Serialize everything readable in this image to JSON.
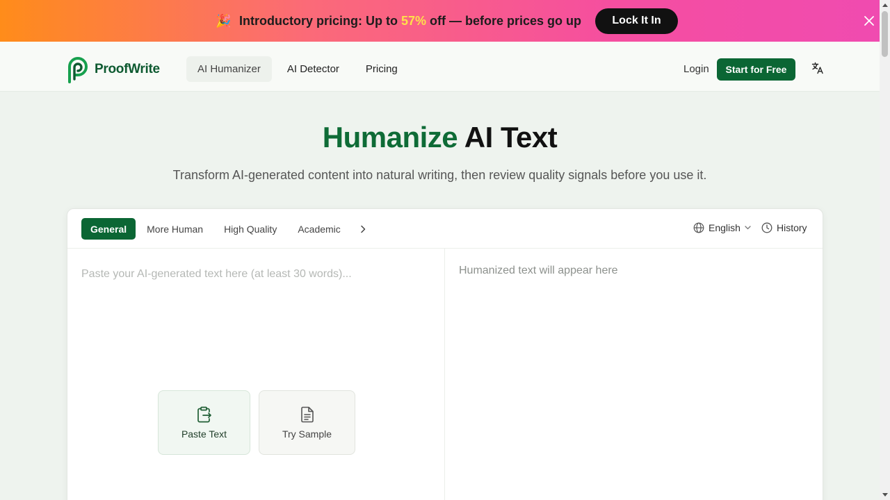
{
  "banner": {
    "icon": "party-popper-icon",
    "text_before": "Introductory pricing: Up to ",
    "percent": "57%",
    "text_after": " off — before prices go up",
    "button_label": "Lock It In"
  },
  "header": {
    "logo_text": "ProofWrite",
    "nav": [
      {
        "label": "AI Humanizer",
        "active": true
      },
      {
        "label": "AI Detector",
        "active": false
      },
      {
        "label": "Pricing",
        "active": false
      }
    ],
    "login_label": "Login",
    "start_label": "Start for Free"
  },
  "hero": {
    "title_green": "Humanize",
    "title_dark": "AI Text",
    "subtitle": "Transform AI-generated content into natural writing, then review quality signals before you use it."
  },
  "editor": {
    "modes": [
      {
        "label": "General",
        "active": true
      },
      {
        "label": "More Human",
        "active": false
      },
      {
        "label": "High Quality",
        "active": false
      },
      {
        "label": "Academic",
        "active": false
      }
    ],
    "language": "English",
    "history_label": "History",
    "input_placeholder": "Paste your AI-generated text here (at least 30 words)...",
    "output_placeholder": "Humanized text will appear here",
    "paste_label": "Paste Text",
    "sample_label": "Try Sample"
  },
  "colors": {
    "brand_green": "#0b6634",
    "banner_start": "#ff8c1a",
    "banner_end": "#f04bb0",
    "highlight_yellow": "#ffe04a"
  }
}
